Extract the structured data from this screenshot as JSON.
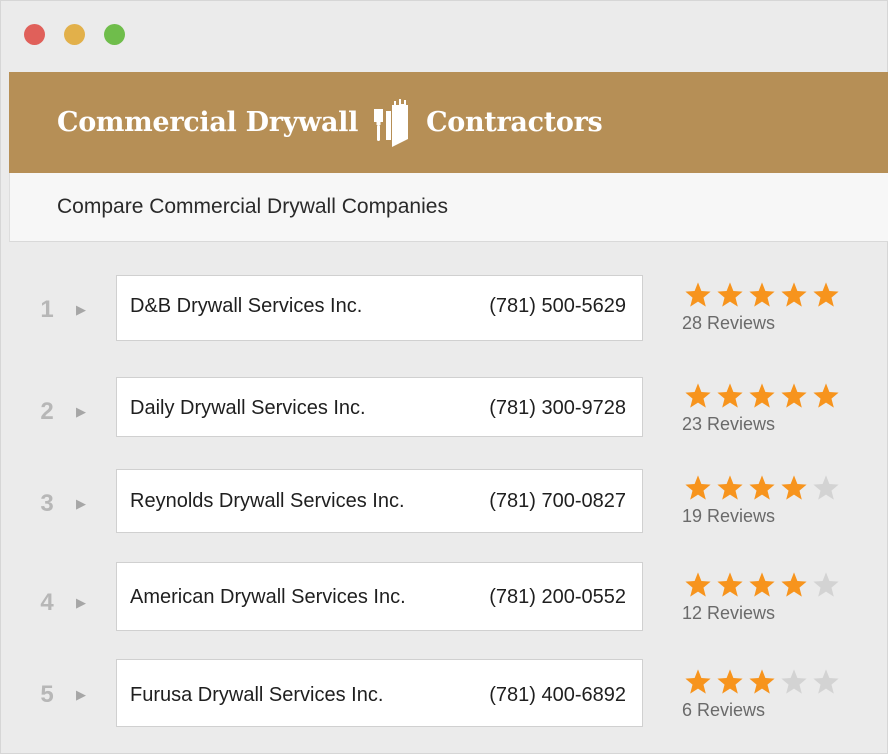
{
  "window": {
    "controls": [
      "close",
      "minimize",
      "maximize"
    ],
    "colors": {
      "close": "#e0605a",
      "minimize": "#e2b04a",
      "maximize": "#6fbd4b"
    }
  },
  "header": {
    "title_left": "Commercial Drywall",
    "title_right": "Contractors",
    "logo_icon": "brush-and-wall-icon",
    "brand_color": "#b68f56"
  },
  "subheader": {
    "title": "Compare Commercial Drywall Companies"
  },
  "colors": {
    "star_filled": "#f7941d",
    "star_empty": "#d3d3d3"
  },
  "listings": [
    {
      "rank": "1",
      "name": "D&B Drywall Services Inc.",
      "phone": "(781) 500-5629",
      "rating": 5,
      "reviews": "28 Reviews"
    },
    {
      "rank": "2",
      "name": "Daily Drywall Services Inc.",
      "phone": "(781) 300-9728",
      "rating": 5,
      "reviews": "23 Reviews"
    },
    {
      "rank": "3",
      "name": "Reynolds Drywall Services Inc.",
      "phone": "(781) 700-0827",
      "rating": 4,
      "reviews": "19 Reviews"
    },
    {
      "rank": "4",
      "name": "American Drywall Services Inc.",
      "phone": "(781) 200-0552",
      "rating": 4,
      "reviews": "12 Reviews"
    },
    {
      "rank": "5",
      "name": "Furusa Drywall Services Inc.",
      "phone": "(781) 400-6892",
      "rating": 3,
      "reviews": "6 Reviews"
    }
  ]
}
